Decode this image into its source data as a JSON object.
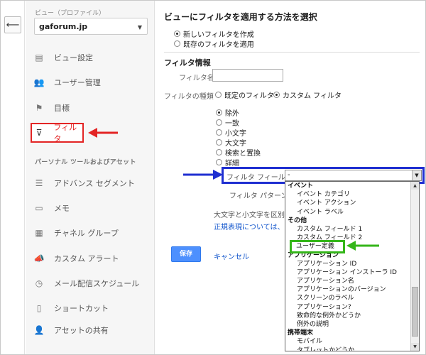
{
  "back_icon": "back-arrow-icon",
  "sidebar": {
    "view_label": "ビュー（プロファイル）",
    "view_select": "gaforum.jp",
    "items": [
      {
        "label": "ビュー設定",
        "icon": "document-icon",
        "glyph": "▤"
      },
      {
        "label": "ユーザー管理",
        "icon": "users-icon",
        "glyph": "👥"
      },
      {
        "label": "目標",
        "icon": "flag-icon",
        "glyph": "⚑"
      },
      {
        "label": "フィルタ",
        "icon": "filter-icon",
        "glyph": "⊽"
      }
    ],
    "section_title": "パーソナル ツールおよびアセット",
    "asset_items": [
      {
        "label": "アドバンス セグメント",
        "icon": "segment-icon",
        "glyph": "☰"
      },
      {
        "label": "メモ",
        "icon": "memo-icon",
        "glyph": "▭"
      },
      {
        "label": "チャネル グループ",
        "icon": "channel-icon",
        "glyph": "▦"
      },
      {
        "label": "カスタム アラート",
        "icon": "megaphone-icon",
        "glyph": "📣"
      },
      {
        "label": "メール配信スケジュール",
        "icon": "clock-icon",
        "glyph": "◷"
      },
      {
        "label": "ショートカット",
        "icon": "shortcut-icon",
        "glyph": "▯"
      },
      {
        "label": "アセットの共有",
        "icon": "share-user-icon",
        "glyph": "👤"
      }
    ]
  },
  "main": {
    "title": "ビューにフィルタを適用する方法を選択",
    "apply_options": [
      {
        "label": "新しいフィルタを作成",
        "selected": true
      },
      {
        "label": "既存のフィルタを適用",
        "selected": false
      }
    ],
    "filter_info_title": "フィルタ情報",
    "filter_name_label": "フィルタ名",
    "filter_name_value": "",
    "filter_type_label": "フィルタの種類",
    "filter_type_options": [
      {
        "label": "既定のフィルタ",
        "selected": false
      },
      {
        "label": "カスタム フィルタ",
        "selected": true
      }
    ],
    "custom_options": [
      {
        "label": "除外",
        "selected": true
      },
      {
        "label": "一致",
        "selected": false
      },
      {
        "label": "小文字",
        "selected": false
      },
      {
        "label": "大文字",
        "selected": false
      },
      {
        "label": "検索と置換",
        "selected": false
      },
      {
        "label": "詳細",
        "selected": false
      }
    ],
    "filter_field_label": "フィルタ フィールド",
    "filter_field_value": "-",
    "filter_pattern_label": "フィルタ パターン",
    "case_sensitive_label": "大文字と小文字を区別",
    "regex_link": "正規表現については、こち",
    "save_label": "保存",
    "cancel_label": "キャンセル"
  },
  "dropdown": {
    "items": [
      {
        "label": "イベント",
        "group": true
      },
      {
        "label": "イベント カテゴリ"
      },
      {
        "label": "イベント アクション"
      },
      {
        "label": "イベント ラベル"
      },
      {
        "label": "その他",
        "group": true
      },
      {
        "label": "カスタム フィールド 1"
      },
      {
        "label": "カスタム フィールド 2"
      },
      {
        "label": "ユーザー定義",
        "highlight": true
      },
      {
        "label": "アプリケーション",
        "group": true
      },
      {
        "label": "アプリケーション ID"
      },
      {
        "label": "アプリケーション インストーラ ID"
      },
      {
        "label": "アプリケーション名"
      },
      {
        "label": "アプリケーションのバージョン"
      },
      {
        "label": "スクリーンのラベル"
      },
      {
        "label": "アプリケーション?"
      },
      {
        "label": "致命的な例外かどうか"
      },
      {
        "label": "例外の説明"
      },
      {
        "label": "携帯端末",
        "group": true
      },
      {
        "label": "モバイル"
      },
      {
        "label": "タブレットかどうか"
      }
    ]
  },
  "annotations": {
    "red_arrow_color": "#e32424",
    "blue_arrow_color": "#1f2fd1",
    "green_arrow_color": "#35b61a"
  }
}
